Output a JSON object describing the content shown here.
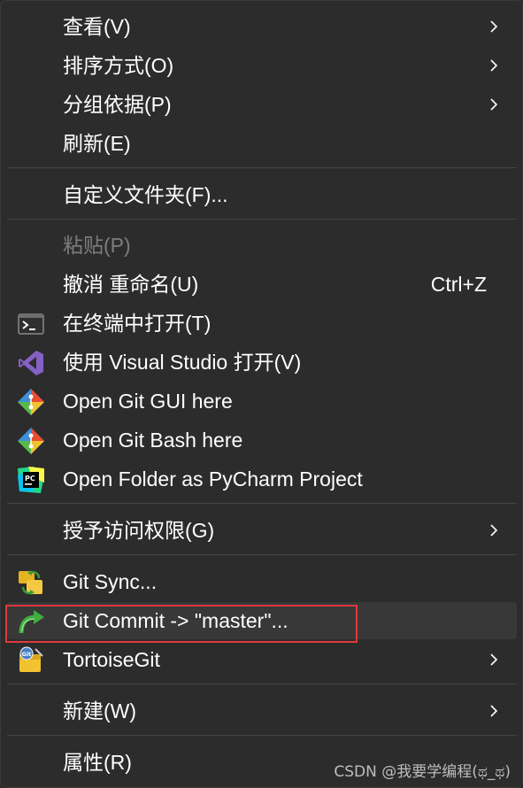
{
  "menu": {
    "view": "查看(V)",
    "sort_by": "排序方式(O)",
    "group_by": "分组依据(P)",
    "refresh": "刷新(E)",
    "customize_folder": "自定义文件夹(F)...",
    "paste": "粘贴(P)",
    "undo_rename": "撤消 重命名(U)",
    "undo_shortcut": "Ctrl+Z",
    "open_terminal": "在终端中打开(T)",
    "open_visual_studio": "使用 Visual Studio 打开(V)",
    "open_git_gui": "Open Git GUI here",
    "open_git_bash": "Open Git Bash here",
    "open_pycharm": "Open Folder as PyCharm Project",
    "grant_access": "授予访问权限(G)",
    "git_sync": "Git Sync...",
    "git_commit": "Git Commit -> \"master\"...",
    "tortoisegit": "TortoiseGit",
    "new": "新建(W)",
    "properties": "属性(R)"
  },
  "icons": {
    "terminal": "terminal-icon",
    "visual_studio": "visual-studio-icon",
    "git_gui": "git-icon",
    "git_bash": "git-icon",
    "pycharm": "pycharm-icon",
    "git_sync": "tortoisegit-sync-icon",
    "git_commit": "tortoisegit-commit-icon",
    "tortoisegit": "tortoisegit-icon",
    "submenu": "chevron-right-icon"
  },
  "watermark": "CSDN @我要学编程(ಥ_ಥ)",
  "colors": {
    "background": "#2c2c2c",
    "hover": "#383838",
    "highlight_border": "#e0393d",
    "disabled_text": "#7d7d7d"
  }
}
